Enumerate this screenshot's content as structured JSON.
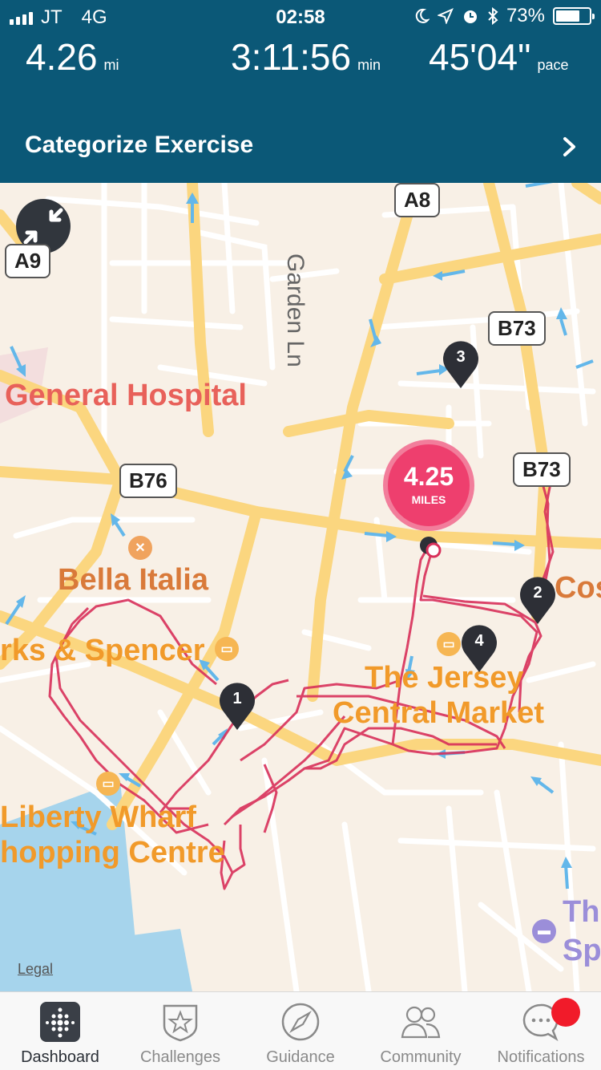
{
  "status_bar": {
    "carrier": "JT",
    "network": "4G",
    "time": "02:58",
    "battery": "73%",
    "battery_level": 0.73
  },
  "stats": {
    "distance": {
      "value": "4.26",
      "unit": "mi"
    },
    "duration": {
      "value": "3:11:56",
      "unit": "min"
    },
    "pace": {
      "value": "45'04\"",
      "unit": "pace"
    }
  },
  "categorize": {
    "label": "Categorize Exercise",
    "icon": "chevron-right-icon"
  },
  "map": {
    "road_signs": [
      "A8",
      "A9",
      "B73",
      "B76",
      "B73"
    ],
    "street_label": "Garden Ln",
    "places": {
      "hospital": "General Hospital",
      "restaurant": "Bella Italia",
      "store": "rks & Spencer",
      "market_line1": "The Jersey",
      "market_line2": "Central Market",
      "wharf_line1": "Liberty Wharf",
      "wharf_line2": "hopping Centre",
      "partial_right": "Cos",
      "hotel_line1": "Th",
      "hotel_line2": "Sp"
    },
    "distance_bubble": {
      "value": "4.25",
      "unit": "MILES"
    },
    "markers": [
      "1",
      "2",
      "3",
      "4"
    ],
    "legal": "Legal",
    "route_color": "#d8305a"
  },
  "tabs": [
    {
      "label": "Dashboard",
      "icon": "dashboard-dots-icon",
      "active": true
    },
    {
      "label": "Challenges",
      "icon": "star-shield-icon",
      "active": false
    },
    {
      "label": "Guidance",
      "icon": "compass-icon",
      "active": false
    },
    {
      "label": "Community",
      "icon": "people-icon",
      "active": false
    },
    {
      "label": "Notifications",
      "icon": "speech-bubble-icon",
      "active": false
    }
  ],
  "colors": {
    "header_bg": "#0b5877",
    "map_bg": "#f8f0e6",
    "road": "#fbd67f",
    "minor_road": "#ffffff",
    "route": "#d8305a",
    "bubble": "#ee3f6e",
    "notification_badge": "#f11b2a"
  }
}
